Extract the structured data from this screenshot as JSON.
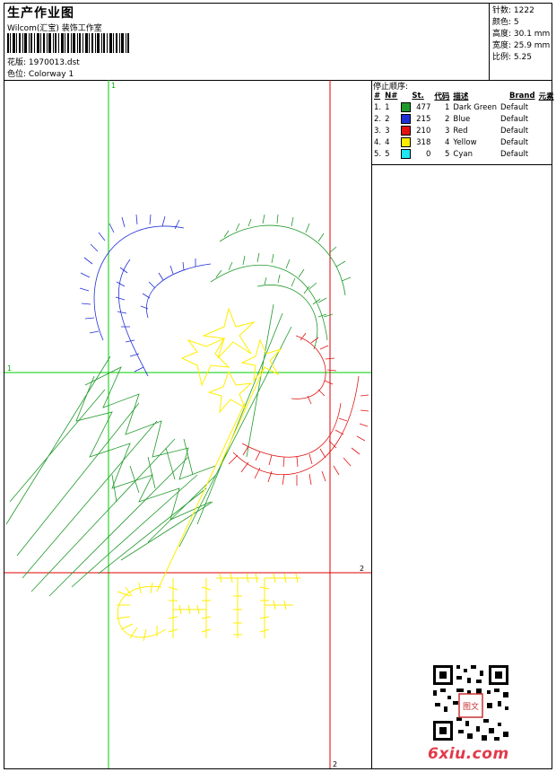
{
  "header": {
    "title": "生产作业图",
    "studio": "Wilcom(汇宝) 装饰工作室",
    "design_label": "花版:",
    "design_value": "1970013.dst",
    "colorway_label": "色位:",
    "colorway_value": "Colorway 1"
  },
  "meta": {
    "stitches": "针数: 1222",
    "colors": "颜色: 5",
    "height": "高度: 30.1 mm",
    "width": "宽度: 25.9 mm",
    "ratio": "比例: 5.25"
  },
  "legend": {
    "title": "停止顺序:",
    "columns": [
      "#",
      "N#",
      "St.",
      "代码",
      "描述",
      "Brand",
      "元素"
    ],
    "rows": [
      {
        "idx": "1.",
        "n": "1",
        "color": "#1f9a2a",
        "st": "477",
        "code": "1",
        "desc": "Dark Green",
        "brand": "Default"
      },
      {
        "idx": "2.",
        "n": "2",
        "color": "#1f2fd6",
        "st": "215",
        "code": "2",
        "desc": "Blue",
        "brand": "Default"
      },
      {
        "idx": "3.",
        "n": "3",
        "color": "#e01414",
        "st": "210",
        "code": "3",
        "desc": "Red",
        "brand": "Default"
      },
      {
        "idx": "4.",
        "n": "4",
        "color": "#ffee00",
        "st": "318",
        "code": "4",
        "desc": "Yellow",
        "brand": "Default"
      },
      {
        "idx": "5.",
        "n": "5",
        "color": "#22e4f0",
        "st": "0",
        "code": "5",
        "desc": "Cyan",
        "brand": "Default"
      }
    ]
  },
  "axes": {
    "top_1": "1",
    "left_1": "1",
    "right_2": "2",
    "bottom_2": "2"
  },
  "design_text": "CHTF",
  "watermark": {
    "site": "6xiu.com",
    "seal": "图文"
  },
  "colors": {
    "guide_green": "#00cc00",
    "guide_red": "#dd0000",
    "thread_green": "#1f9a2a",
    "thread_blue": "#1f2fd6",
    "thread_red": "#e01414",
    "thread_yellow": "#ffee00"
  }
}
